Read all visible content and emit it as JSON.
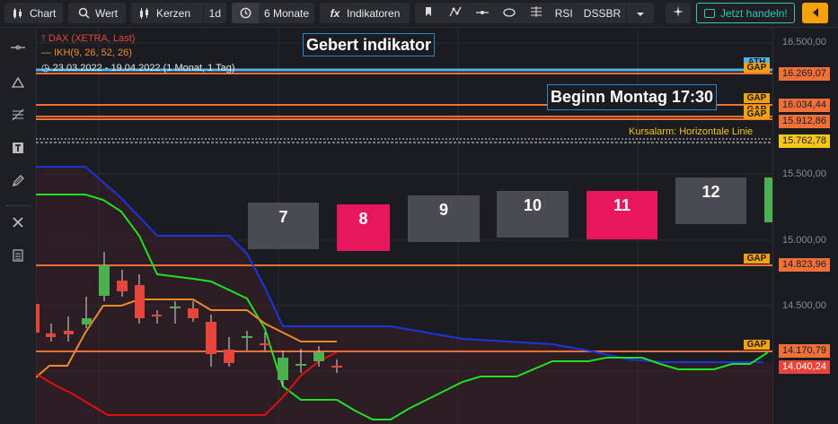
{
  "toolbar": {
    "chart_label": "Chart",
    "wert_label": "Wert",
    "kerzen_label": "Kerzen",
    "interval_label": "1d",
    "range_label": "6 Monate",
    "indikatoren_label": "Indikatoren",
    "rsi_label": "RSI",
    "dssbr_label": "DSSBR",
    "trade_label": "Jetzt handeln!"
  },
  "legend": {
    "dax": "DAX (XETRA, Last)",
    "ikh": "IKH(9, 26, 52, 26)",
    "period": "23.03.2022 - 19.04.2022  (1 Monat, 1 Tag)"
  },
  "notes": {
    "gebert": "Gebert  indikator",
    "beginn": "Beginn Montag 17:30"
  },
  "kursalarm": "Kursalarm: Horizontale Linie",
  "day_boxes": [
    "7",
    "8",
    "9",
    "10",
    "11",
    "12"
  ],
  "y_axis": {
    "ticks": [
      "16.500,00",
      "15.500,00",
      "15.000,00",
      "14.500,00"
    ],
    "price_labels": [
      "16.269,07",
      "16.034,44",
      "15.912,86",
      "15.762,78",
      "14.823,96",
      "14.170,79",
      "14.040,24"
    ],
    "gap_label": "GAP",
    "ath_label": "ATH"
  },
  "colors": {
    "accent": "#f5a20a",
    "trade": "#34c6b6",
    "level_line": "#f0703a",
    "ath_line": "#4fb3f0",
    "candle_up": "#4caf50",
    "candle_down": "#e8453a",
    "ikh_blue": "#1a35e0",
    "ikh_green": "#22e022",
    "ikh_orange": "#f08a2a",
    "ikh_red": "#e01010"
  }
}
